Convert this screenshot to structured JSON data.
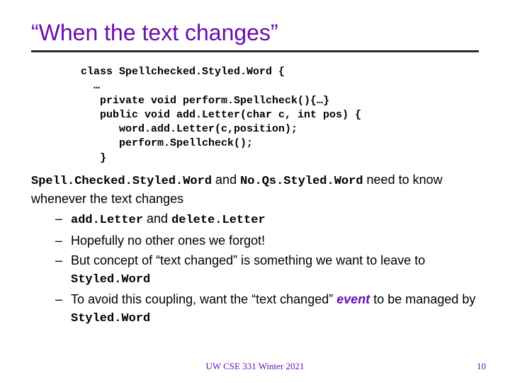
{
  "title": "“When the text changes”",
  "code": "class Spellchecked.Styled.Word {\n  …\n   private void perform.Spellcheck(){…}\n   public void add.Letter(char c, int pos) {\n      word.add.Letter(c,position);\n      perform.Spellcheck();\n   }",
  "para": {
    "class1": "Spell.Checked.Styled.Word",
    "mid": " and ",
    "class2": "No.Qs.Styled.Word",
    "tail": " need to know whenever the text changes"
  },
  "bullets": {
    "b1": {
      "code1": "add.Letter",
      "mid": " and ",
      "code2": "delete.Letter"
    },
    "b2": "Hopefully no other ones we forgot!",
    "b3": {
      "pre": "But concept of “text changed” is something we want to leave to ",
      "code": "Styled.Word"
    },
    "b4": {
      "pre": "To avoid this coupling, want the “text changed” ",
      "em": "event",
      "mid": " to be managed by ",
      "code": "Styled.Word"
    }
  },
  "footer": "UW CSE 331 Winter 2021",
  "page": "10"
}
